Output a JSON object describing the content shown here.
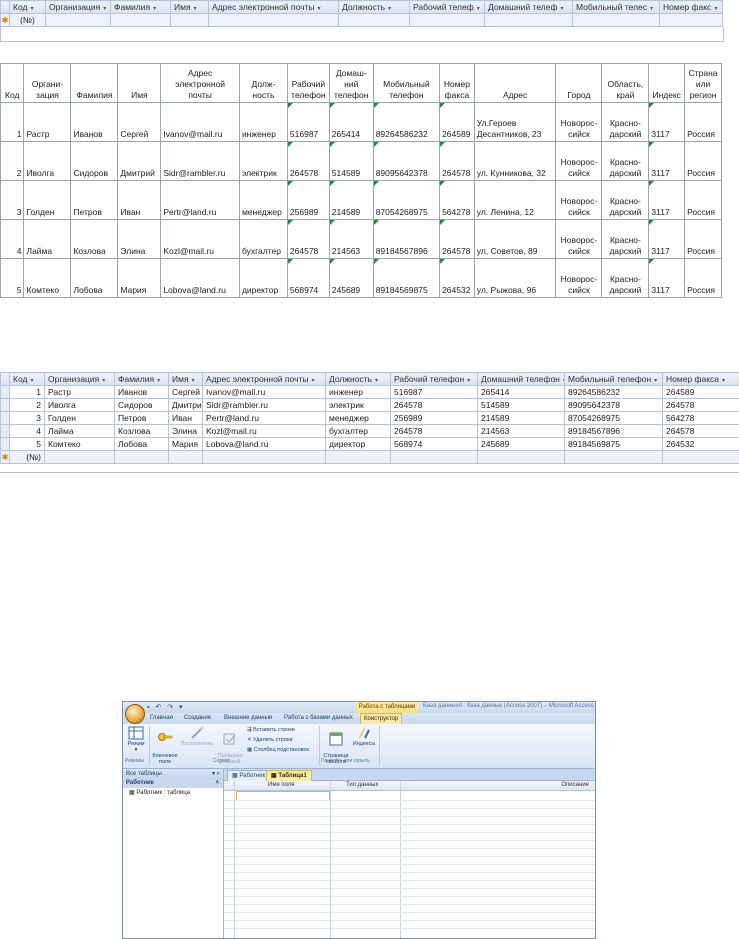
{
  "colors": {
    "excel_corner_marker": "#1f8b3a",
    "new_row_star": "#d68400",
    "ribbon_tab_active": "#fbe8a8"
  },
  "grid1": {
    "headers": [
      "Код",
      "Организация",
      "Фамилия",
      "Имя",
      "Адрес электронной почты",
      "Должность",
      "Рабочий телеф",
      "Домашний телеф",
      "Мобильный телес",
      "Номер факс"
    ],
    "new_row_marker": "✱",
    "new_row_value": "(№)"
  },
  "excel": {
    "headers": [
      "Код",
      "Органи-\nзация",
      "Фамилия",
      "Имя",
      "Адрес\nэлектронной\nпочты",
      "Долж-\nность",
      "Рабочий\nтелефон",
      "Домаш-\nний\nтелефон",
      "Мобильный\nтелефон",
      "Номер\nфакса",
      "Адрес",
      "Город",
      "Область,\nкрай",
      "Индекс",
      "Страна\nили\nрегион"
    ],
    "rows": [
      [
        "1",
        "Растр",
        "Иванов",
        "Сергей",
        "Ivanov@mail.ru",
        "инженер",
        "516987",
        "265414",
        "89264586232",
        "264589",
        "Ул.Героев\nДесантников, 23",
        "Новорос-\nсийск",
        "Красно-\nдарский",
        "3117",
        "Россия"
      ],
      [
        "2",
        "Иволга",
        "Сидоров",
        "Дмитрий",
        "Sidr@rambler.ru",
        "электрик",
        "264578",
        "514589",
        "89095642378",
        "264578",
        "ул. Кунникова, 32",
        "Новорос-\nсийск",
        "Красно-\nдарский",
        "3117",
        "Россия"
      ],
      [
        "3",
        "Голден",
        "Петров",
        "Иван",
        "Pertr@land.ru",
        "менеджер",
        "256989",
        "214589",
        "87054268975",
        "564278",
        "ул. Ленина, 12",
        "Новорос-\nсийск",
        "Красно-\nдарский",
        "3117",
        "Россия"
      ],
      [
        "4",
        "Лайма",
        "Козлова",
        "Элина",
        "Kozl@mail.ru",
        "бухгалтер",
        "264578",
        "214563",
        "89184567896",
        "264578",
        "ул, Советов, 89",
        "Новорос-\nсийск",
        "Красно-\nдарский",
        "3117",
        "Россия"
      ],
      [
        "5",
        "Комтеко",
        "Лобова",
        "Мария",
        "Lobova@land.ru",
        "директор",
        "568974",
        "245689",
        "89184569875",
        "264532",
        "ул, Рыжова, 96",
        "Новорос-\nсийск",
        "Красно-\nдарский",
        "3117",
        "Россия"
      ]
    ]
  },
  "grid2": {
    "headers": [
      "Код",
      "Организация",
      "Фамилия",
      "Имя",
      "Адрес электронной почты",
      "Должность",
      "Рабочий телефон",
      "Домашний телефон",
      "Мобильный телефон",
      "Номер факса"
    ],
    "rows": [
      [
        "1",
        "Растр",
        "Иванов",
        "Сергей",
        "Ivanov@mail.ru",
        "инженер",
        "516987",
        "265414",
        "89264586232",
        "264589"
      ],
      [
        "2",
        "Иволга",
        "Сидоров",
        "Дмитри",
        "Sidr@rambler.ru",
        "электрик",
        "264578",
        "514589",
        "89095642378",
        "264578"
      ],
      [
        "3",
        "Голден",
        "Петров",
        "Иван",
        "Pertr@land.ru",
        "менеджер",
        "256989",
        "214589",
        "87054268975",
        "564278"
      ],
      [
        "4",
        "Лайма",
        "Козлова",
        "Элина",
        "Kozl@mail.ru",
        "бухгалтер",
        "264578",
        "214563",
        "89184567896",
        "264578"
      ],
      [
        "5",
        "Комтеко",
        "Лобова",
        "Мария",
        "Lobova@land.ru",
        "директор",
        "568974",
        "245689",
        "89184569875",
        "264532"
      ]
    ],
    "new_row_marker": "✱",
    "new_row_value": "(№)"
  },
  "access": {
    "context_group": "Работа с таблицами",
    "window_title": "База данных4 : база данных (Access 2007) – Microsoft Access",
    "ribbon_tabs": [
      "Главная",
      "Создание",
      "Внешние данные",
      "Работа с базами данных",
      "Конструктор"
    ],
    "active_tab": "Конструктор",
    "buttons": {
      "mode": "Режим",
      "key": "Ключевое\nполе",
      "builder": "Построитель",
      "test": "Проверка\nусловий",
      "insert_rows": "Вставить строки",
      "delete_rows": "Удалить строки",
      "lookup_column": "Столбец подстановок",
      "property_sheet": "Страница\nсвойств",
      "indexes": "Индексы"
    },
    "groups": [
      "Режимы",
      "Сервис",
      "Показать или скрыть"
    ],
    "nav": {
      "header": "Все таблицы",
      "group": "Работник",
      "item": "Работник : таблица"
    },
    "doc_tabs": [
      "Работник",
      "Таблица1"
    ],
    "design_columns": [
      "Имя поля",
      "Тип данных",
      "Описание"
    ]
  }
}
